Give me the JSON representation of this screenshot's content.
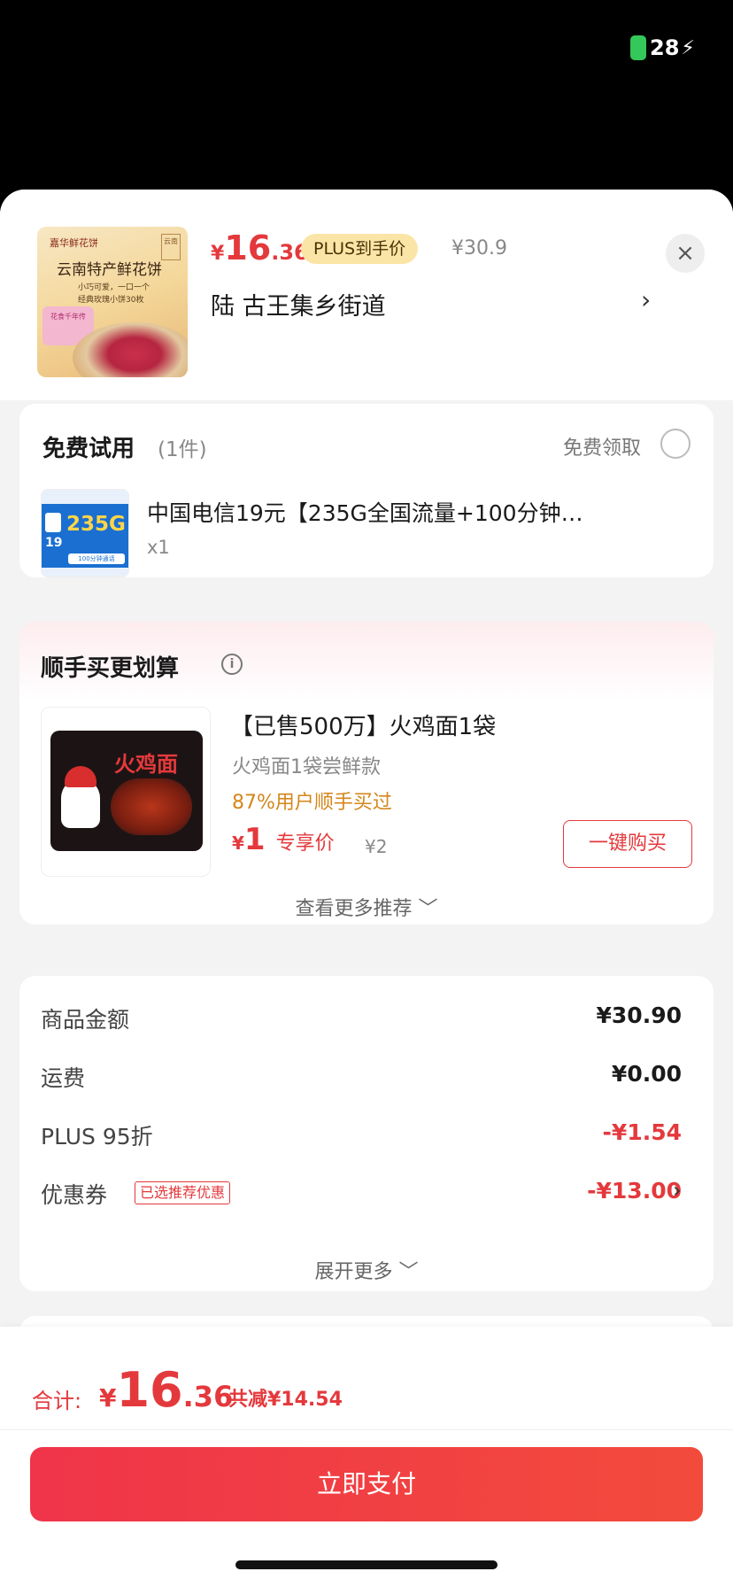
{
  "status": {
    "battery": "28"
  },
  "product": {
    "thumb_brand": "嘉华鲜花饼",
    "thumb_seal": "云南",
    "thumb_title": "云南特产鲜花饼",
    "thumb_sub1": "小巧可爱，一口一个",
    "thumb_sub2": "经典玫瑰小饼30枚",
    "thumb_tag": "花食千年传",
    "price_symbol": "¥",
    "price_int": "16",
    "price_dec": ".36",
    "plus_tag": "PLUS到手价",
    "orig_price": "¥30.9",
    "address": "陆  古王集乡街道",
    "close": "×",
    "chevron": "›"
  },
  "trial": {
    "title": "免费试用",
    "count": "(1件)",
    "claim": "免费领取",
    "thumb_big": "235G",
    "thumb_num": "19",
    "thumb_bar": "100分钟通话",
    "item_name": "中国电信19元【235G全国流量+100分钟…",
    "item_qty": "x1"
  },
  "reco": {
    "title": "顺手买更划算",
    "info_icon": "i",
    "thumb_title": "火鸡面",
    "name": "【已售500万】火鸡面1袋",
    "sub": "火鸡面1袋尝鲜款",
    "bought": "87%用户顺手买过",
    "price_symbol": "¥",
    "price": "1",
    "price_label": "专享价",
    "orig_price": "¥2",
    "buy_button": "一键购买",
    "more": "查看更多推荐 ﹀"
  },
  "amounts": {
    "rows": [
      {
        "label": "商品金额",
        "value": "¥30.90"
      },
      {
        "label": "运费",
        "value": "¥0.00"
      },
      {
        "label": "PLUS 95折",
        "value": "-¥1.54"
      },
      {
        "label": "优惠券",
        "value": "-¥13.00",
        "tag": "已选推荐优惠"
      }
    ],
    "chevron": "›",
    "expand": "展开更多 ﹀"
  },
  "footer": {
    "total_label": "合计:",
    "total_symbol": "¥",
    "total_int": "16",
    "total_dec": ".36",
    "saved": "共减¥14.54",
    "pay_button": "立即支付"
  },
  "colors": {
    "accent": "#e4393c",
    "plus_gold": "#fbe5a6",
    "bought_orange": "#d4861b"
  }
}
